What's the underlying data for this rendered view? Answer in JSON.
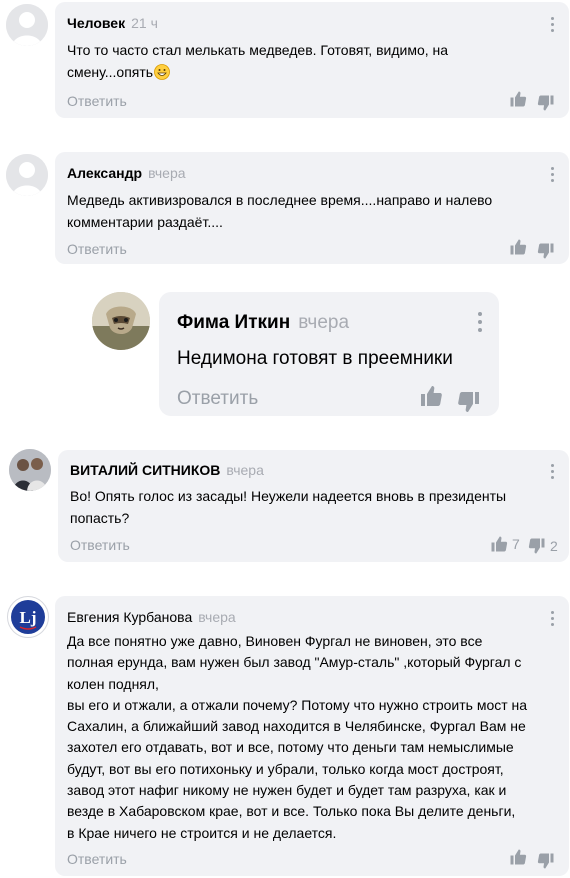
{
  "ui": {
    "reply_label": "Ответить"
  },
  "comments": [
    {
      "author": "Человек",
      "time": "21 ч",
      "lines": [
        "Что то часто стал мелькать медведев. Готовят, видимо, на",
        "смену...опять"
      ],
      "emoji": "grinning-face"
    },
    {
      "author": "Александр",
      "time": "вчера",
      "lines": [
        "Медведь активизровался в последнее время....направо и налево",
        "комментарии раздаёт...."
      ]
    },
    {
      "author": "Фима Иткин",
      "time": "вчера",
      "lines": [
        "Недимона готовят в преемники"
      ]
    },
    {
      "author": "ВИТАЛИЙ СИТНИКОВ",
      "time": "вчера",
      "lines": [
        "Во! Опять голос из засады! Неужели надеется вновь в президенты",
        "попасть?"
      ],
      "likes": "7",
      "dislikes": "2"
    },
    {
      "author": "Евгения Курбанова",
      "time": "вчера",
      "avatar_text": "Lj",
      "lines": [
        "Да все понятно уже давно,  Виновен Фургал не виновен,  это все",
        "полная ерунда,  вам нужен был завод \"Амур-сталь\" ,который Фургал с",
        "колен поднял,",
        "вы его и отжали,  а отжали почему? Потому что нужно строить мост на",
        "Сахалин,  а ближайший завод находится в Челябинске,  Фургал Вам не",
        "захотел его отдавать,  вот и все,  потому что  деньги там немыслимые",
        "будут,  вот вы его потихоньку и убрали,  только когда мост достроят,",
        "завод этот нафиг никому не нужен будет и будет там разруха,  как и",
        "везде в Хабаровском крае,  вот и все.  Только пока Вы делите деньги,",
        "в Крае ничего не строится и не делается."
      ]
    }
  ],
  "colors": {
    "bubble": "#f1f2f5",
    "muted": "#9aa0a8",
    "time": "#a8abb2",
    "lj_blue": "#1f3d99",
    "lj_red": "#d8262c"
  }
}
